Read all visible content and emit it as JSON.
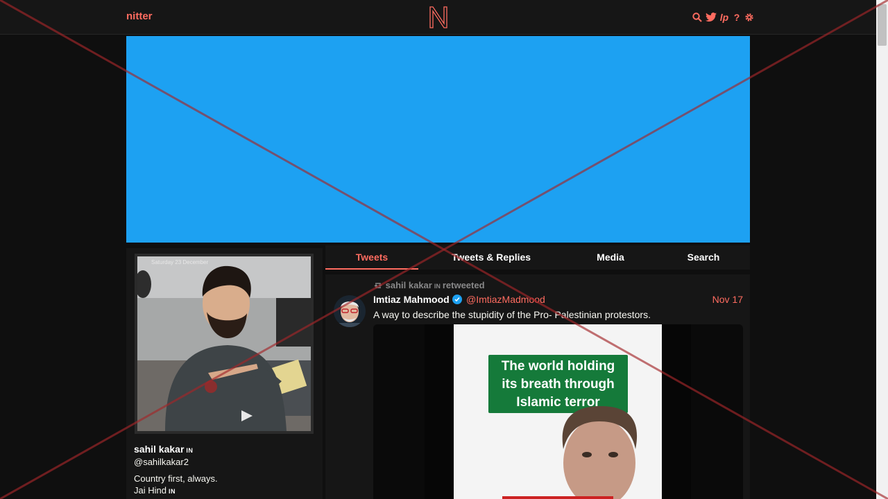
{
  "navbar": {
    "brand": "nitter",
    "logo": "N",
    "icons": [
      "search-icon",
      "twitter-bird-icon",
      "lp-icon",
      "help-icon",
      "gear-icon"
    ],
    "lp_text": "lp",
    "help_text": "?"
  },
  "profile": {
    "photo_caption": "Saturday 23 December",
    "fullname": "sahil kakar",
    "flag": "IN",
    "username": "@sahilkakar2",
    "bio_line1": "Country first, always.",
    "bio_line2": "Jai Hind",
    "bio_flag": "IN"
  },
  "tabs": [
    {
      "label": "Tweets",
      "active": true
    },
    {
      "label": "Tweets & Replies",
      "active": false
    },
    {
      "label": "Media",
      "active": false
    },
    {
      "label": "Search",
      "active": false
    }
  ],
  "tweet": {
    "retweeter": "sahil kakar",
    "retweeter_flag": "IN",
    "retweet_suffix": "retweeted",
    "name": "Imtiaz Mahmood",
    "handle": "@ImtiazMadmood",
    "date": "Nov 17",
    "text": "A way to describe the stupidity of the Pro- Palestinian protestors.",
    "media_text_line1": "The world holding",
    "media_text_line2": "its breath through",
    "media_text_line3": "Islamic terror"
  },
  "colors": {
    "accent": "#ff6c60",
    "banner": "#1da1f2",
    "background": "#0f0f0f",
    "panel": "#161616",
    "overlay_green": "#157a3a"
  }
}
